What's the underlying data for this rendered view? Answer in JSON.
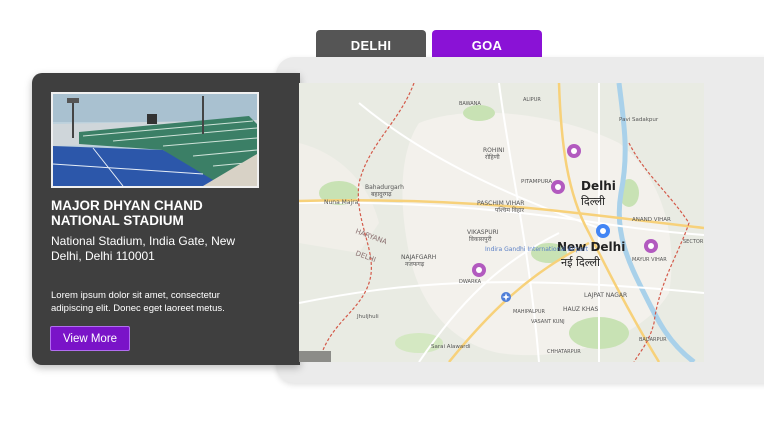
{
  "tabs": [
    {
      "label": "DELHI",
      "active": false,
      "color": "#555555"
    },
    {
      "label": "GOA",
      "active": true,
      "color": "#8a12d6"
    }
  ],
  "venue": {
    "name": "MAJOR DHYAN CHAND NATIONAL STADIUM",
    "address": "National Stadium, India Gate, New Delhi, Delhi 110001",
    "description": "Lorem ipsum dolor sit amet, consectetur adipiscing elit. Donec eget laoreet metus.",
    "button_label": "View More"
  },
  "map": {
    "labels": {
      "delhi": "Delhi",
      "delhi_hi": "दिल्ली",
      "new_delhi": "New Delhi",
      "new_delhi_hi": "नई दिल्ली",
      "rohini": "ROHINI",
      "rohini_hi": "रोहिणी",
      "pitampura": "PITAMPURA",
      "paschim_vihar": "PASCHIM VIHAR",
      "paschim_vihar_hi": "पश्चिम विहार",
      "vikaspuri": "VIKASPURI",
      "vikaspuri_hi": "विकासपुरी",
      "najafgarh": "NAJAFGARH",
      "najafgarh_hi": "नजफगढ़",
      "bahadurgarh": "Bahadurgarh",
      "bahadurgarh_hi": "बहादुरगढ़",
      "haryana": "HARYANA",
      "delhi_state": "DELHI",
      "airport": "Indira Gandhi International Airport",
      "anand_vihar": "ANAND VIHAR",
      "mayur_vihar": "MAYUR VIHAR",
      "lajpat_nagar": "LAJPAT NAGAR",
      "hauz_khas": "HAUZ KHAS",
      "pavi_sadakpur": "Pavi Sadakpur",
      "nuna_majra": "Nuna Majra",
      "jhuljhuli": "Jhuljhuli",
      "sarai_alawardi": "Sarai Alawardi",
      "dwarka": "DWARKA",
      "bawana": "BAWANA",
      "alipur": "ALIPUR",
      "chhatarpur": "CHHATARPUR",
      "vasant_kunj": "VASANT KUNJ",
      "mahipalpur": "MAHIPALPUR",
      "badarpur": "BADARPUR",
      "sector": "SECTOR"
    },
    "colors": {
      "land": "#e9ebe3",
      "urban": "#f3f1ec",
      "park": "#c8e2b4",
      "water": "#a9d1ea",
      "road": "#ffffff",
      "highway": "#f7d17a",
      "border": "#d45a4a",
      "marker": "#b25abf",
      "current": "#4285f4"
    }
  },
  "photo": {
    "sky": "#b6ccd9",
    "turf": "#2e56a8",
    "stands": "#3e8e6f"
  }
}
